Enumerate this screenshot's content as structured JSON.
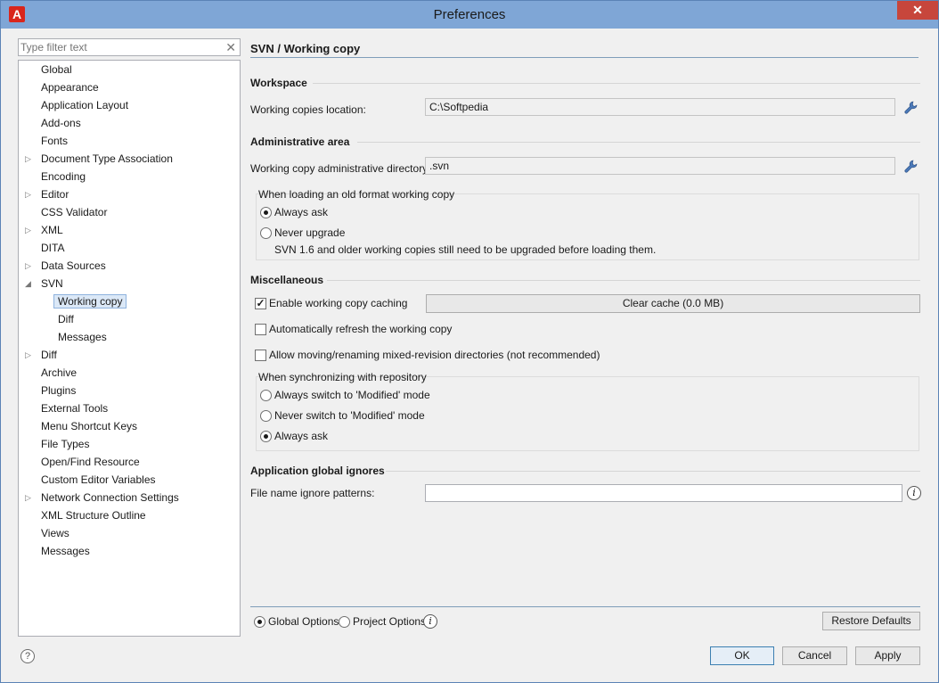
{
  "window": {
    "title": "Preferences",
    "close_glyph": "✕",
    "app_icon_letter": "A"
  },
  "filter": {
    "placeholder": "Type filter text",
    "clear_glyph": "✕"
  },
  "tree": [
    {
      "label": "Global",
      "arrow": ""
    },
    {
      "label": "Appearance",
      "arrow": ""
    },
    {
      "label": "Application Layout",
      "arrow": ""
    },
    {
      "label": "Add-ons",
      "arrow": ""
    },
    {
      "label": "Fonts",
      "arrow": ""
    },
    {
      "label": "Document Type Association",
      "arrow": "▷"
    },
    {
      "label": "Encoding",
      "arrow": ""
    },
    {
      "label": "Editor",
      "arrow": "▷"
    },
    {
      "label": "CSS Validator",
      "arrow": ""
    },
    {
      "label": "XML",
      "arrow": "▷"
    },
    {
      "label": "DITA",
      "arrow": ""
    },
    {
      "label": "Data Sources",
      "arrow": "▷"
    },
    {
      "label": "SVN",
      "arrow": "◢"
    },
    {
      "label": "Working copy",
      "arrow": ""
    },
    {
      "label": "Diff",
      "arrow": ""
    },
    {
      "label": "Messages",
      "arrow": ""
    },
    {
      "label": "Diff",
      "arrow": "▷"
    },
    {
      "label": "Archive",
      "arrow": ""
    },
    {
      "label": "Plugins",
      "arrow": ""
    },
    {
      "label": "External Tools",
      "arrow": ""
    },
    {
      "label": "Menu Shortcut Keys",
      "arrow": ""
    },
    {
      "label": "File Types",
      "arrow": ""
    },
    {
      "label": "Open/Find Resource",
      "arrow": ""
    },
    {
      "label": "Custom Editor Variables",
      "arrow": ""
    },
    {
      "label": "Network Connection Settings",
      "arrow": "▷"
    },
    {
      "label": "XML Structure Outline",
      "arrow": ""
    },
    {
      "label": "Views",
      "arrow": ""
    },
    {
      "label": "Messages",
      "arrow": ""
    }
  ],
  "panel": {
    "title": "SVN / Working copy",
    "workspace": {
      "heading": "Workspace",
      "location_label": "Working copies location:",
      "location_value": "C:\\Softpedia"
    },
    "admin": {
      "heading": "Administrative area",
      "dir_label": "Working copy administrative directory",
      "dir_value": ".svn",
      "group_title": "When loading an old format working copy",
      "opt_always_ask": "Always ask",
      "opt_never_upgrade": "Never upgrade",
      "note": "SVN 1.6 and older working copies still need to be upgraded before loading them."
    },
    "misc": {
      "heading": "Miscellaneous",
      "enable_caching": "Enable working copy caching",
      "clear_cache": "Clear cache (0.0 MB)",
      "auto_refresh": "Automatically refresh the working copy",
      "allow_moving": "Allow moving/renaming mixed-revision directories (not recommended)",
      "sync_group_title": "When synchronizing with repository",
      "opt_always_switch": "Always switch to 'Modified' mode",
      "opt_never_switch": "Never switch to 'Modified' mode",
      "opt_always_ask": "Always ask"
    },
    "ignores": {
      "heading": "Application global ignores",
      "label": "File name ignore patterns:",
      "value": ""
    }
  },
  "bottom": {
    "global_options": "Global Options",
    "project_options": "Project Options",
    "restore_defaults": "Restore Defaults",
    "ok": "OK",
    "cancel": "Cancel",
    "apply": "Apply",
    "help_glyph": "?",
    "info_glyph": "i"
  }
}
